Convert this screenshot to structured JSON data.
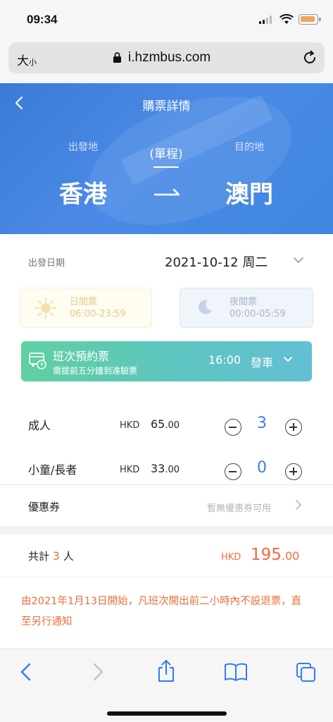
{
  "status_bar": {
    "time": "09:34"
  },
  "browser": {
    "text_size_label": "大",
    "text_size_small": "小",
    "url": "i.hzmbus.com"
  },
  "header": {
    "title": "購票詳情",
    "from_label": "出發地",
    "to_label": "目的地",
    "trip_type": "(單程)",
    "from_city": "香港",
    "to_city": "澳門"
  },
  "departure": {
    "label": "出發日期",
    "date": "2021-10-12 周二"
  },
  "ticket_types": [
    {
      "name": "日間票",
      "hours": "06:00-23:59",
      "icon": "sun-icon"
    },
    {
      "name": "夜間票",
      "hours": "00:00-05:59",
      "icon": "moon-icon"
    }
  ],
  "booking": {
    "title": "班次預約票",
    "subtitle": "需提前五分鐘到達驗票",
    "time": "16:00",
    "action": "發車"
  },
  "passengers": [
    {
      "type": "成人",
      "currency": "HKD",
      "price_int": "65",
      "price_dec": ".00",
      "count": "3"
    },
    {
      "type": "小童/長者",
      "currency": "HKD",
      "price_int": "33",
      "price_dec": ".00",
      "count": "0"
    }
  ],
  "coupon": {
    "label": "優惠券",
    "value": "暫無優惠券可用"
  },
  "total": {
    "label_prefix": "共計",
    "people": "3",
    "label_suffix": "人",
    "currency": "HKD",
    "amount_int": "195",
    "amount_dec": ".00"
  },
  "notice": "由2021年1月13日開始，凡班次開出前二小時內不設退票，直至另行通知",
  "colors": {
    "header_blue": "#3f86e0",
    "accent_orange": "#f06b3a",
    "count_blue": "#3d7fe0",
    "booking_green": "#5fd0a1",
    "booking_teal": "#63bfd4"
  }
}
